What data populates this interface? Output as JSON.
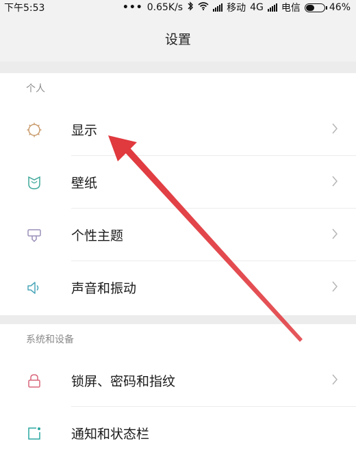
{
  "status_bar": {
    "time": "下午5:53",
    "speed": "0.65K/s",
    "carrier1": "移动",
    "network": "4G",
    "carrier2": "电信",
    "battery": "46%",
    "battery_level": 0.46
  },
  "header": {
    "title": "设置"
  },
  "sections": [
    {
      "title": "个人",
      "items": [
        {
          "label": "显示",
          "icon": "brightness-icon",
          "color": "#c99a6b"
        },
        {
          "label": "壁纸",
          "icon": "wallpaper-icon",
          "color": "#3fa89a"
        },
        {
          "label": "个性主题",
          "icon": "theme-brush-icon",
          "color": "#9a8fb8"
        },
        {
          "label": "声音和振动",
          "icon": "speaker-icon",
          "color": "#4aa6b8"
        }
      ]
    },
    {
      "title": "系统和设备",
      "items": [
        {
          "label": "锁屏、密码和指纹",
          "icon": "lock-icon",
          "color": "#d8667a"
        },
        {
          "label": "通知和状态栏",
          "icon": "notification-icon",
          "color": "#2aa7a0"
        }
      ]
    }
  ],
  "annotation": {
    "arrow_color": "#e0393e"
  }
}
